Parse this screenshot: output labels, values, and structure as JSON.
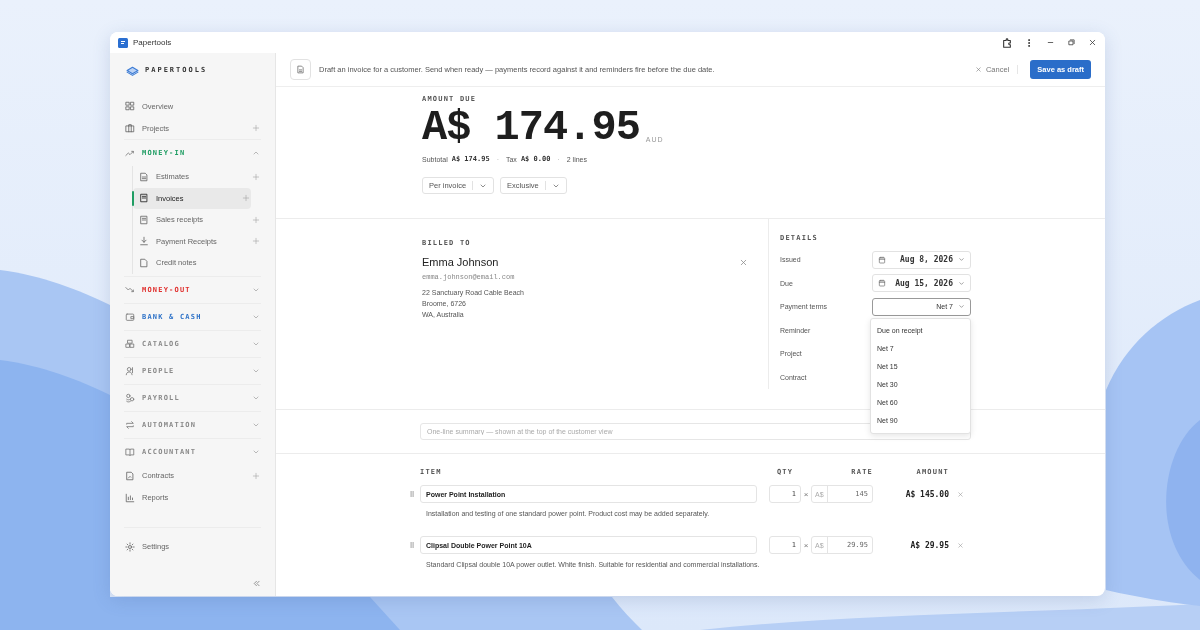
{
  "window": {
    "title": "Papertools"
  },
  "sidebar": {
    "brand": "PAPERTOOLS",
    "items": [
      {
        "kind": "link",
        "label": "Overview",
        "add": false,
        "selected": false
      },
      {
        "kind": "link",
        "label": "Projects",
        "add": true,
        "selected": false
      },
      {
        "kind": "section",
        "label": "MONEY-IN",
        "color": "#1f9d63",
        "expanded": true,
        "children": [
          {
            "label": "Estimates",
            "add": true,
            "selected": false
          },
          {
            "label": "Invoices",
            "add": true,
            "selected": true
          },
          {
            "label": "Sales receipts",
            "add": true,
            "selected": false
          },
          {
            "label": "Payment Receipts",
            "add": true,
            "selected": false
          },
          {
            "label": "Credit notes",
            "add": false,
            "selected": false
          }
        ]
      },
      {
        "kind": "section",
        "label": "MONEY-OUT",
        "color": "#e0302e",
        "expanded": false
      },
      {
        "kind": "section",
        "label": "BANK & CASH",
        "color": "#2f73c8",
        "expanded": false
      },
      {
        "kind": "section",
        "label": "CATALOG",
        "color": "#8a8a8a",
        "expanded": false
      },
      {
        "kind": "section",
        "label": "PEOPLE",
        "color": "#8a8a8a",
        "expanded": false
      },
      {
        "kind": "section",
        "label": "PAYROLL",
        "color": "#8a8a8a",
        "expanded": false
      },
      {
        "kind": "section",
        "label": "AUTOMATION",
        "color": "#8a8a8a",
        "expanded": false
      },
      {
        "kind": "section",
        "label": "ACCOUNTANT",
        "color": "#8a8a8a",
        "expanded": false
      },
      {
        "kind": "link",
        "label": "Contracts",
        "add": true,
        "selected": false
      },
      {
        "kind": "link",
        "label": "Reports",
        "add": false,
        "selected": false
      }
    ],
    "footer": {
      "label": "Settings"
    }
  },
  "header": {
    "description": "Draft an invoice for a customer. Send when ready — payments record against it and reminders fire before the due date.",
    "cancel": "Cancel",
    "save": "Save as draft"
  },
  "amount": {
    "label": "AMOUNT DUE",
    "value": "A$ 174.95",
    "currency": "AUD",
    "subtotal_label": "Subtotal",
    "subtotal": "A$ 174.95",
    "tax_label": "Tax",
    "tax": "A$ 0.00",
    "lines": "2 lines",
    "separators": [
      "·",
      "·"
    ],
    "selects": [
      "Per invoice",
      "Exclusive"
    ]
  },
  "billed_to": {
    "label": "BILLED TO",
    "name": "Emma Johnson",
    "email": "emma.johnson@email.com",
    "address": [
      "22 Sanctuary Road Cable Beach",
      "Broome, 6726",
      "WA, Australia"
    ]
  },
  "details": {
    "label": "DETAILS",
    "rows": [
      {
        "kind": "date",
        "label": "Issued",
        "value": "Aug 8, 2026"
      },
      {
        "kind": "date",
        "label": "Due",
        "value": "Aug 15, 2026"
      },
      {
        "kind": "select",
        "label": "Payment terms",
        "value": "Net 7",
        "expanded": true,
        "options": [
          "Due on receipt",
          "Net 7",
          "Net 15",
          "Net 30",
          "Net 60",
          "Net 90"
        ]
      },
      {
        "kind": "empty",
        "label": "Reminder"
      },
      {
        "kind": "empty",
        "label": "Project"
      },
      {
        "kind": "empty",
        "label": "Contract"
      }
    ]
  },
  "summary": {
    "placeholder": "One-line summary — shown at the top of the customer view"
  },
  "table": {
    "columns": [
      "ITEM",
      "QTY",
      "RATE",
      "AMOUNT"
    ],
    "rows": [
      {
        "item": "Power Point Installation",
        "description": "Installation and testing of one standard power point. Product cost may be added separately.",
        "qty": "1",
        "times": "×",
        "currency": "A$",
        "rate": "145",
        "amount": "A$ 145.00"
      },
      {
        "item": "Clipsal Double Power Point 10A",
        "description": "Standard Clipsal double 10A power outlet. White finish. Suitable for residential and commercial installations.",
        "qty": "1",
        "times": "×",
        "currency": "A$",
        "rate": "29.95",
        "amount": "A$ 29.95"
      }
    ]
  }
}
